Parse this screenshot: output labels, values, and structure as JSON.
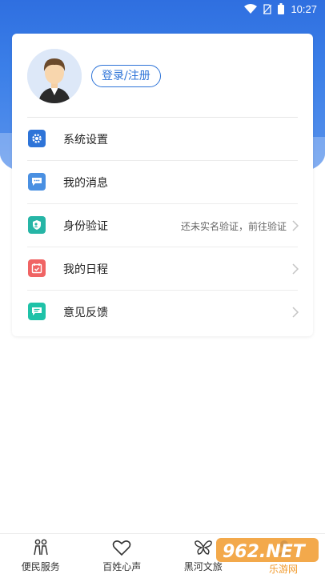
{
  "status_bar": {
    "time": "10:27",
    "icons": [
      "wifi-icon",
      "no-sim-icon",
      "battery-icon"
    ]
  },
  "profile": {
    "login_label": "登录/注册"
  },
  "menu": {
    "items": [
      {
        "label": "系统设置",
        "icon": "gear-icon",
        "color": "#2e74d8",
        "hint": ""
      },
      {
        "label": "我的消息",
        "icon": "message-icon",
        "color": "#4a90e2",
        "hint": ""
      },
      {
        "label": "身份验证",
        "icon": "id-verify-icon",
        "color": "#26b5a6",
        "hint": "还未实名验证，前往验证"
      },
      {
        "label": "我的日程",
        "icon": "calendar-icon",
        "color": "#f06464",
        "hint": ""
      },
      {
        "label": "意见反馈",
        "icon": "feedback-icon",
        "color": "#1fc2a8",
        "hint": ""
      }
    ]
  },
  "tabbar": {
    "tabs": [
      {
        "label": "便民服务",
        "icon": "people-icon"
      },
      {
        "label": "百姓心声",
        "icon": "heart-icon"
      },
      {
        "label": "黑河文旅",
        "icon": "butterfly-icon"
      },
      {
        "label": "",
        "icon": "profile-icon"
      }
    ]
  },
  "watermark": {
    "text": "962.NET",
    "subtext": "乐游网"
  },
  "colors": {
    "hero": "#3b7fe8",
    "accent": "#2e74d8"
  }
}
